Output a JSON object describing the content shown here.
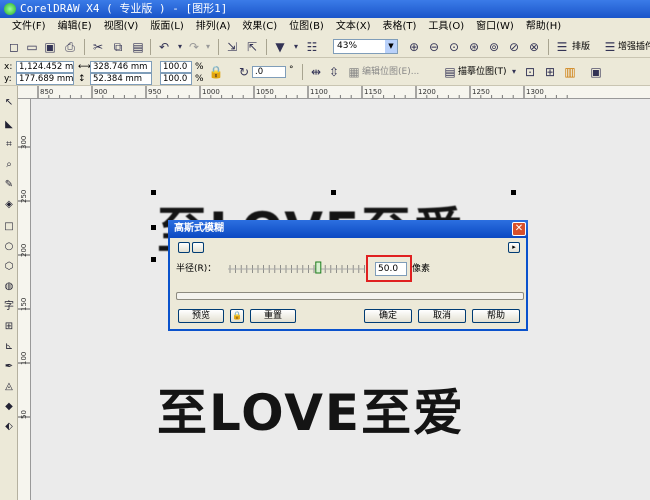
{
  "window": {
    "title": "CorelDRAW X4 ( 专业版 ) - [图形1]"
  },
  "menu": [
    "文件(F)",
    "编辑(E)",
    "视图(V)",
    "版面(L)",
    "排列(A)",
    "效果(C)",
    "位图(B)",
    "文本(X)",
    "表格(T)",
    "工具(O)",
    "窗口(W)",
    "帮助(H)"
  ],
  "toolbar": {
    "zoom": "43%",
    "layout_label": "排版",
    "enhance_label": "增强插件",
    "trace_label": "描摹位图(T)",
    "edit_bitmap_label": "编辑位图(E)..."
  },
  "propbar": {
    "x": "1,124.452 mm",
    "y": "177.689 mm",
    "w": "328.746 mm",
    "h": "52.384 mm",
    "scale_x": "100.0",
    "scale_y": "100.0",
    "pct": "%",
    "angle": ".0",
    "deg": "°",
    "x_label": "x:",
    "y_label": "y:"
  },
  "ruler": {
    "h_ticks": [
      "850",
      "900",
      "950",
      "1000",
      "1050",
      "1100",
      "1150",
      "1200",
      "1250",
      "1300"
    ],
    "v_ticks": [
      "300",
      "250",
      "200",
      "150",
      "100",
      "50"
    ]
  },
  "canvas": {
    "text_top": "至LOVE至爱",
    "text_bottom": "至LOVE至爱"
  },
  "dialog": {
    "title": "高斯式模糊",
    "radius_label": "半径(R)：",
    "radius_value": "50.0",
    "unit": "像素",
    "preview": "预览",
    "reset": "重置",
    "ok": "确定",
    "cancel": "取消",
    "help": "帮助"
  },
  "colors": {
    "titlebar": "#1a55c9",
    "highlight_box": "#e02020"
  }
}
